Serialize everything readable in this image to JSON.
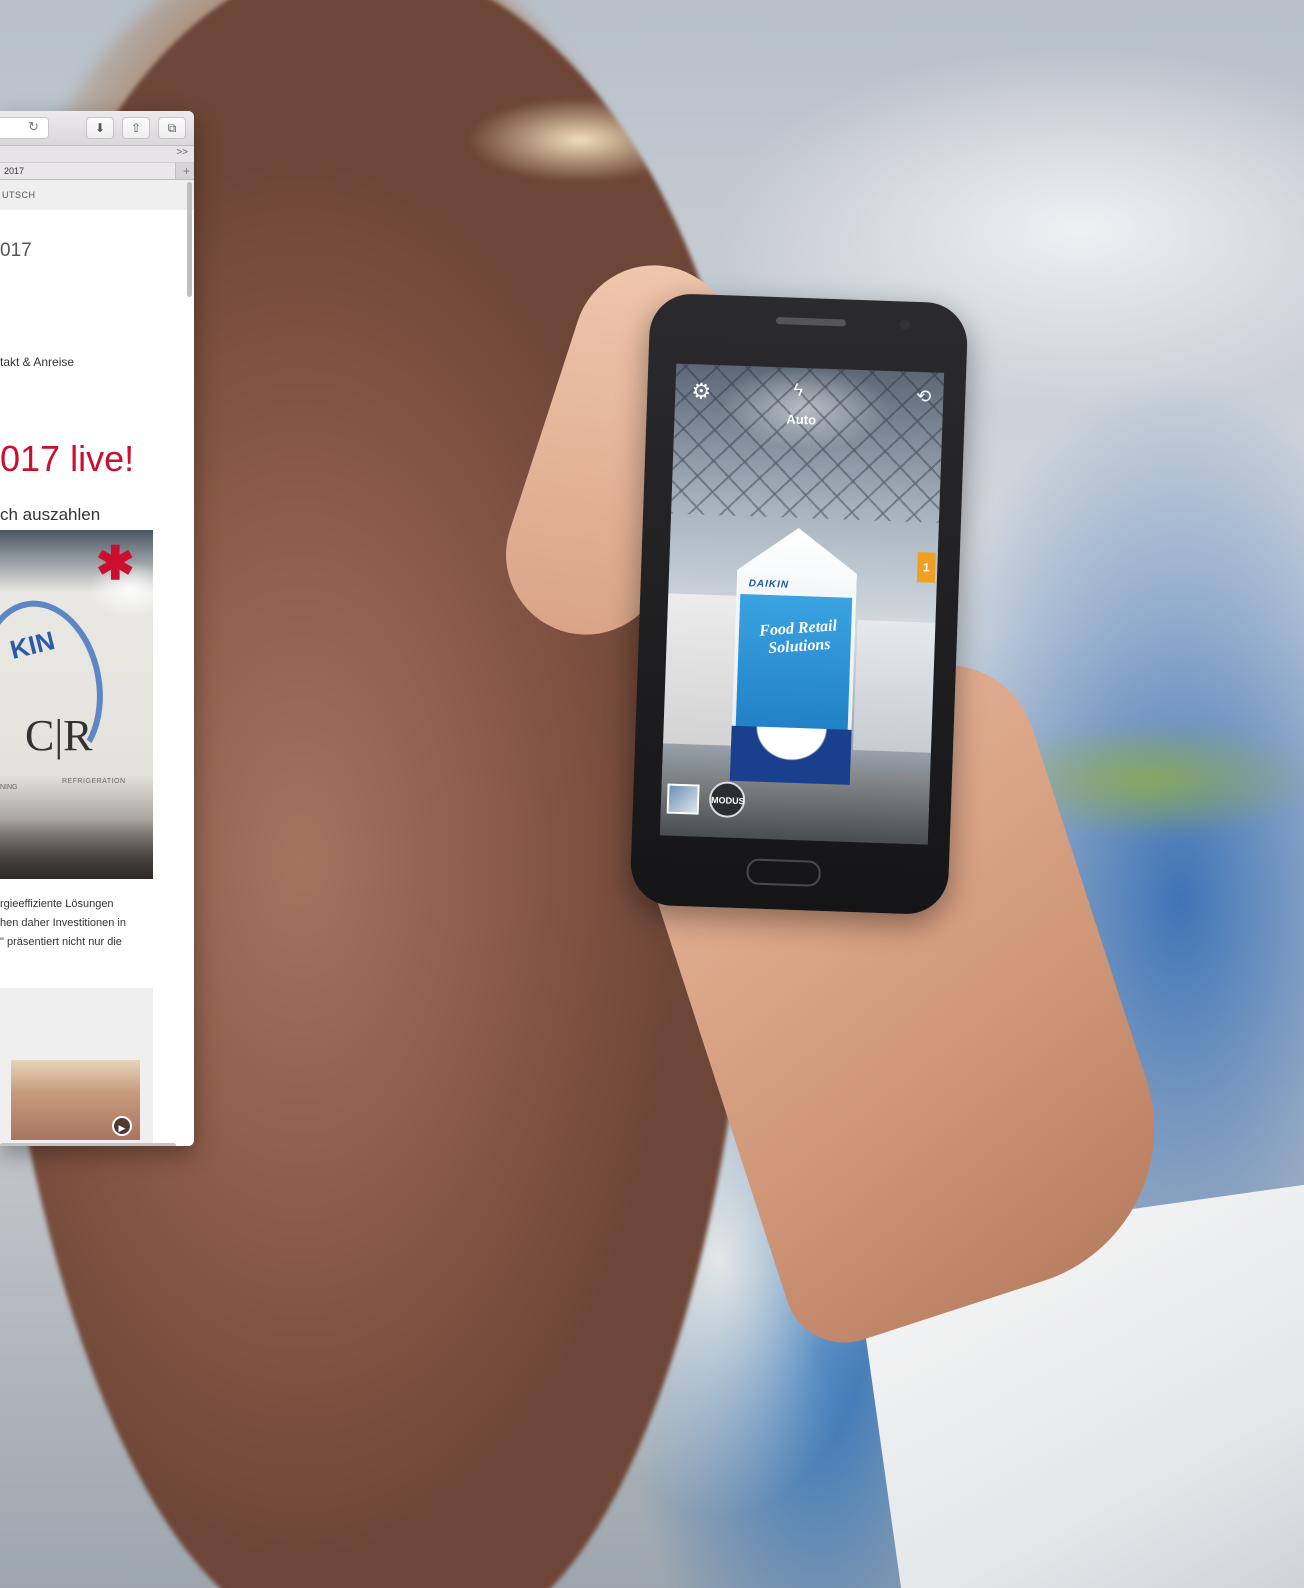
{
  "browser": {
    "tab_label": "2017",
    "bookmarks_more": ">>",
    "new_tab": "+",
    "language": "UTSCH",
    "page_year": "017",
    "nav_link": "takt & Anreise",
    "headline": "017 live!",
    "subhead": "ch auszahlen",
    "hero": {
      "brand": "KIN",
      "logo": "C|R",
      "caption_right": "REFRIGERATION",
      "caption_left": "NING"
    },
    "body_text": [
      "rgieeffiziente Lösungen",
      "hen daher Investitionen in",
      "\" präsentiert nicht nur die"
    ]
  },
  "phone": {
    "camera_flash_mode": "Auto",
    "mode_button": "MODUS",
    "carton_brand": "DAIKIN",
    "carton_title": "Food Retail Solutions",
    "side_badge": "1"
  },
  "colors": {
    "headline_red": "#cc0f2e",
    "brand_blue": "#2b5aa8"
  }
}
